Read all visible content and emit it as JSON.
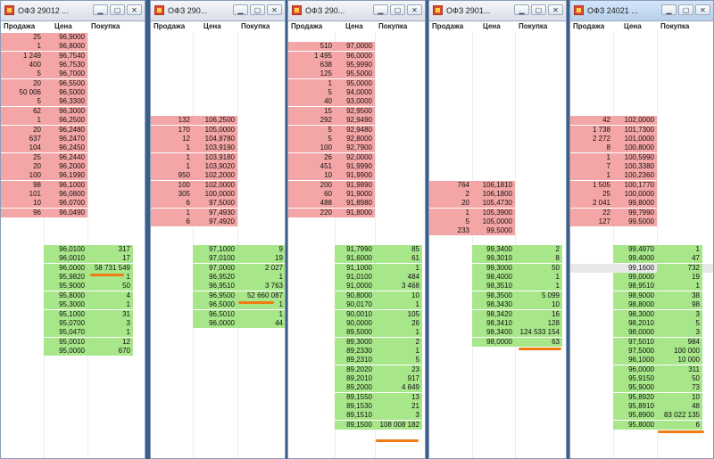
{
  "headers": {
    "sell": "Продажа",
    "price": "Цена",
    "buy": "Покупка"
  },
  "buttons": {
    "minimize": "▁",
    "maximize": "▢",
    "close": "✕"
  },
  "windows": [
    {
      "title": "ОФЗ 29012 ...",
      "asks": [
        [
          "25",
          "96,9000"
        ],
        [
          "1",
          "96,8000"
        ],
        [
          "1 249",
          "96,7540"
        ],
        [
          "400",
          "96,7530"
        ],
        [
          "5",
          "96,7000"
        ],
        [
          "20",
          "96,5500"
        ],
        [
          "50 006",
          "96,5000"
        ],
        [
          "5",
          "96,3300"
        ],
        [
          "62",
          "96,3000"
        ],
        [
          "1",
          "96,2500"
        ],
        [
          "20",
          "96,2480"
        ],
        [
          "637",
          "96,2470"
        ],
        [
          "104",
          "96,2450"
        ],
        [
          "25",
          "96,2440"
        ],
        [
          "20",
          "96,2000"
        ],
        [
          "100",
          "96,1990"
        ],
        [
          "98",
          "96,1000"
        ],
        [
          "101",
          "96,0800"
        ],
        [
          "10",
          "96,0700"
        ],
        [
          "96",
          "96,0490"
        ]
      ],
      "bids": [
        [
          "96,0100",
          "317"
        ],
        [
          "96,0010",
          "17"
        ],
        [
          "96,0000",
          "58 731 549"
        ],
        [
          "95,9820",
          "1"
        ],
        [
          "95,9000",
          "50"
        ],
        [
          "95,8000",
          "4"
        ],
        [
          "95,3000",
          "1"
        ],
        [
          "95,1000",
          "31"
        ],
        [
          "95,0700",
          "3"
        ],
        [
          "95,0470",
          "1"
        ],
        [
          "95,0010",
          "12"
        ],
        [
          "95,0000",
          "670"
        ]
      ]
    },
    {
      "title": "ОФЗ 290...",
      "asks": [
        [
          "132",
          "106,2500"
        ],
        [
          "170",
          "105,0000"
        ],
        [
          "12",
          "104,8780"
        ],
        [
          "1",
          "103,9190"
        ],
        [
          "1",
          "103,9180"
        ],
        [
          "1",
          "103,9020"
        ],
        [
          "950",
          "102,2000"
        ],
        [
          "100",
          "102,0000"
        ],
        [
          "305",
          "100,0000"
        ],
        [
          "6",
          "97,5000"
        ],
        [
          "1",
          "97,4930"
        ],
        [
          "6",
          "97,4920"
        ]
      ],
      "bids": [
        [
          "97,1000",
          "9"
        ],
        [
          "97,0100",
          "19"
        ],
        [
          "97,0000",
          "2 027"
        ],
        [
          "96,9520",
          "1"
        ],
        [
          "96,9510",
          "3 763"
        ],
        [
          "96,9500",
          "52 660 087"
        ],
        [
          "96,5000",
          "1"
        ],
        [
          "96,5010",
          "1"
        ],
        [
          "96,0000",
          "44"
        ]
      ]
    },
    {
      "title": "ОФЗ 290...",
      "asks": [
        [
          "510",
          "97,0000"
        ],
        [
          "1 495",
          "96,0000"
        ],
        [
          "638",
          "95,9990"
        ],
        [
          "125",
          "95,5000"
        ],
        [
          "1",
          "95,0000"
        ],
        [
          "5",
          "94,0000"
        ],
        [
          "40",
          "93,0000"
        ],
        [
          "15",
          "92,9500"
        ],
        [
          "292",
          "92,9490"
        ],
        [
          "5",
          "92,9480"
        ],
        [
          "5",
          "92,8000"
        ],
        [
          "100",
          "92,7900"
        ],
        [
          "26",
          "92,0000"
        ],
        [
          "451",
          "91,9990"
        ],
        [
          "10",
          "91,9900"
        ],
        [
          "200",
          "91,9890"
        ],
        [
          "60",
          "91,9000"
        ],
        [
          "488",
          "91,8980"
        ],
        [
          "220",
          "91,8000"
        ]
      ],
      "bids": [
        [
          "91,7990",
          "85"
        ],
        [
          "91,6000",
          "61"
        ],
        [
          "91,1000",
          "1"
        ],
        [
          "91,0100",
          "484"
        ],
        [
          "91,0000",
          "3 468"
        ],
        [
          "90,8000",
          "10"
        ],
        [
          "90,0170",
          "1"
        ],
        [
          "90,0010",
          "105"
        ],
        [
          "90,0000",
          "26"
        ],
        [
          "89,5000",
          "1"
        ],
        [
          "89,3000",
          "2"
        ],
        [
          "89,2330",
          "1"
        ],
        [
          "89,2310",
          "5"
        ],
        [
          "89,2020",
          "23"
        ],
        [
          "89,2010",
          "917"
        ],
        [
          "89,2000",
          "4 849"
        ],
        [
          "89,1550",
          "13"
        ],
        [
          "89,1530",
          "21"
        ],
        [
          "89,1510",
          "3"
        ],
        [
          "89,1500",
          "108 008 182"
        ]
      ]
    },
    {
      "title": "ОФЗ 2901...",
      "asks": [
        [
          "764",
          "106,1810"
        ],
        [
          "2",
          "106,1800"
        ],
        [
          "20",
          "105,4730"
        ],
        [
          "1",
          "105,3900"
        ],
        [
          "5",
          "105,0000"
        ],
        [
          "233",
          "99,5000"
        ]
      ],
      "bids": [
        [
          "99,3400",
          "2"
        ],
        [
          "99,3010",
          "8"
        ],
        [
          "99,3000",
          "50"
        ],
        [
          "98,4000",
          "1"
        ],
        [
          "98,3510",
          "1"
        ],
        [
          "98,3500",
          "5 099"
        ],
        [
          "98,3430",
          "10"
        ],
        [
          "98,3420",
          "16"
        ],
        [
          "98,3410",
          "128"
        ],
        [
          "98,3400",
          "124 533 154"
        ],
        [
          "98,0000",
          "63"
        ]
      ]
    },
    {
      "title": "ОФЗ 24021 ...",
      "asks": [
        [
          "42",
          "102,0000"
        ],
        [
          "1 738",
          "101,7300"
        ],
        [
          "2 272",
          "101,0000"
        ],
        [
          "8",
          "100,8000"
        ],
        [
          "1",
          "100,5990"
        ],
        [
          "7",
          "100,3380"
        ],
        [
          "1",
          "100,2360"
        ],
        [
          "1 505",
          "100,1770"
        ],
        [
          "25",
          "100,0000"
        ],
        [
          "2 041",
          "99,8000"
        ],
        [
          "22",
          "99,7990"
        ],
        [
          "127",
          "99,5000"
        ]
      ],
      "bids": [
        [
          "99,4970",
          "1"
        ],
        [
          "99,4000",
          "47"
        ],
        [
          "99,1600",
          "732"
        ],
        [
          "99,0000",
          "19"
        ],
        [
          "98,9510",
          "1"
        ],
        [
          "98,9000",
          "38"
        ],
        [
          "98,8000",
          "98"
        ],
        [
          "98,3000",
          "3"
        ],
        [
          "98,2010",
          "5"
        ],
        [
          "98,0000",
          "3"
        ],
        [
          "97,5010",
          "984"
        ],
        [
          "97,5000",
          "100 000"
        ],
        [
          "96,1000",
          "10 000"
        ],
        [
          "96,0000",
          "311"
        ],
        [
          "95,9150",
          "50"
        ],
        [
          "95,9000",
          "73"
        ],
        [
          "95,8920",
          "10"
        ],
        [
          "95,8910",
          "48"
        ],
        [
          "95,8900",
          "83 022 135"
        ],
        [
          "95,8000",
          "6"
        ]
      ]
    }
  ]
}
